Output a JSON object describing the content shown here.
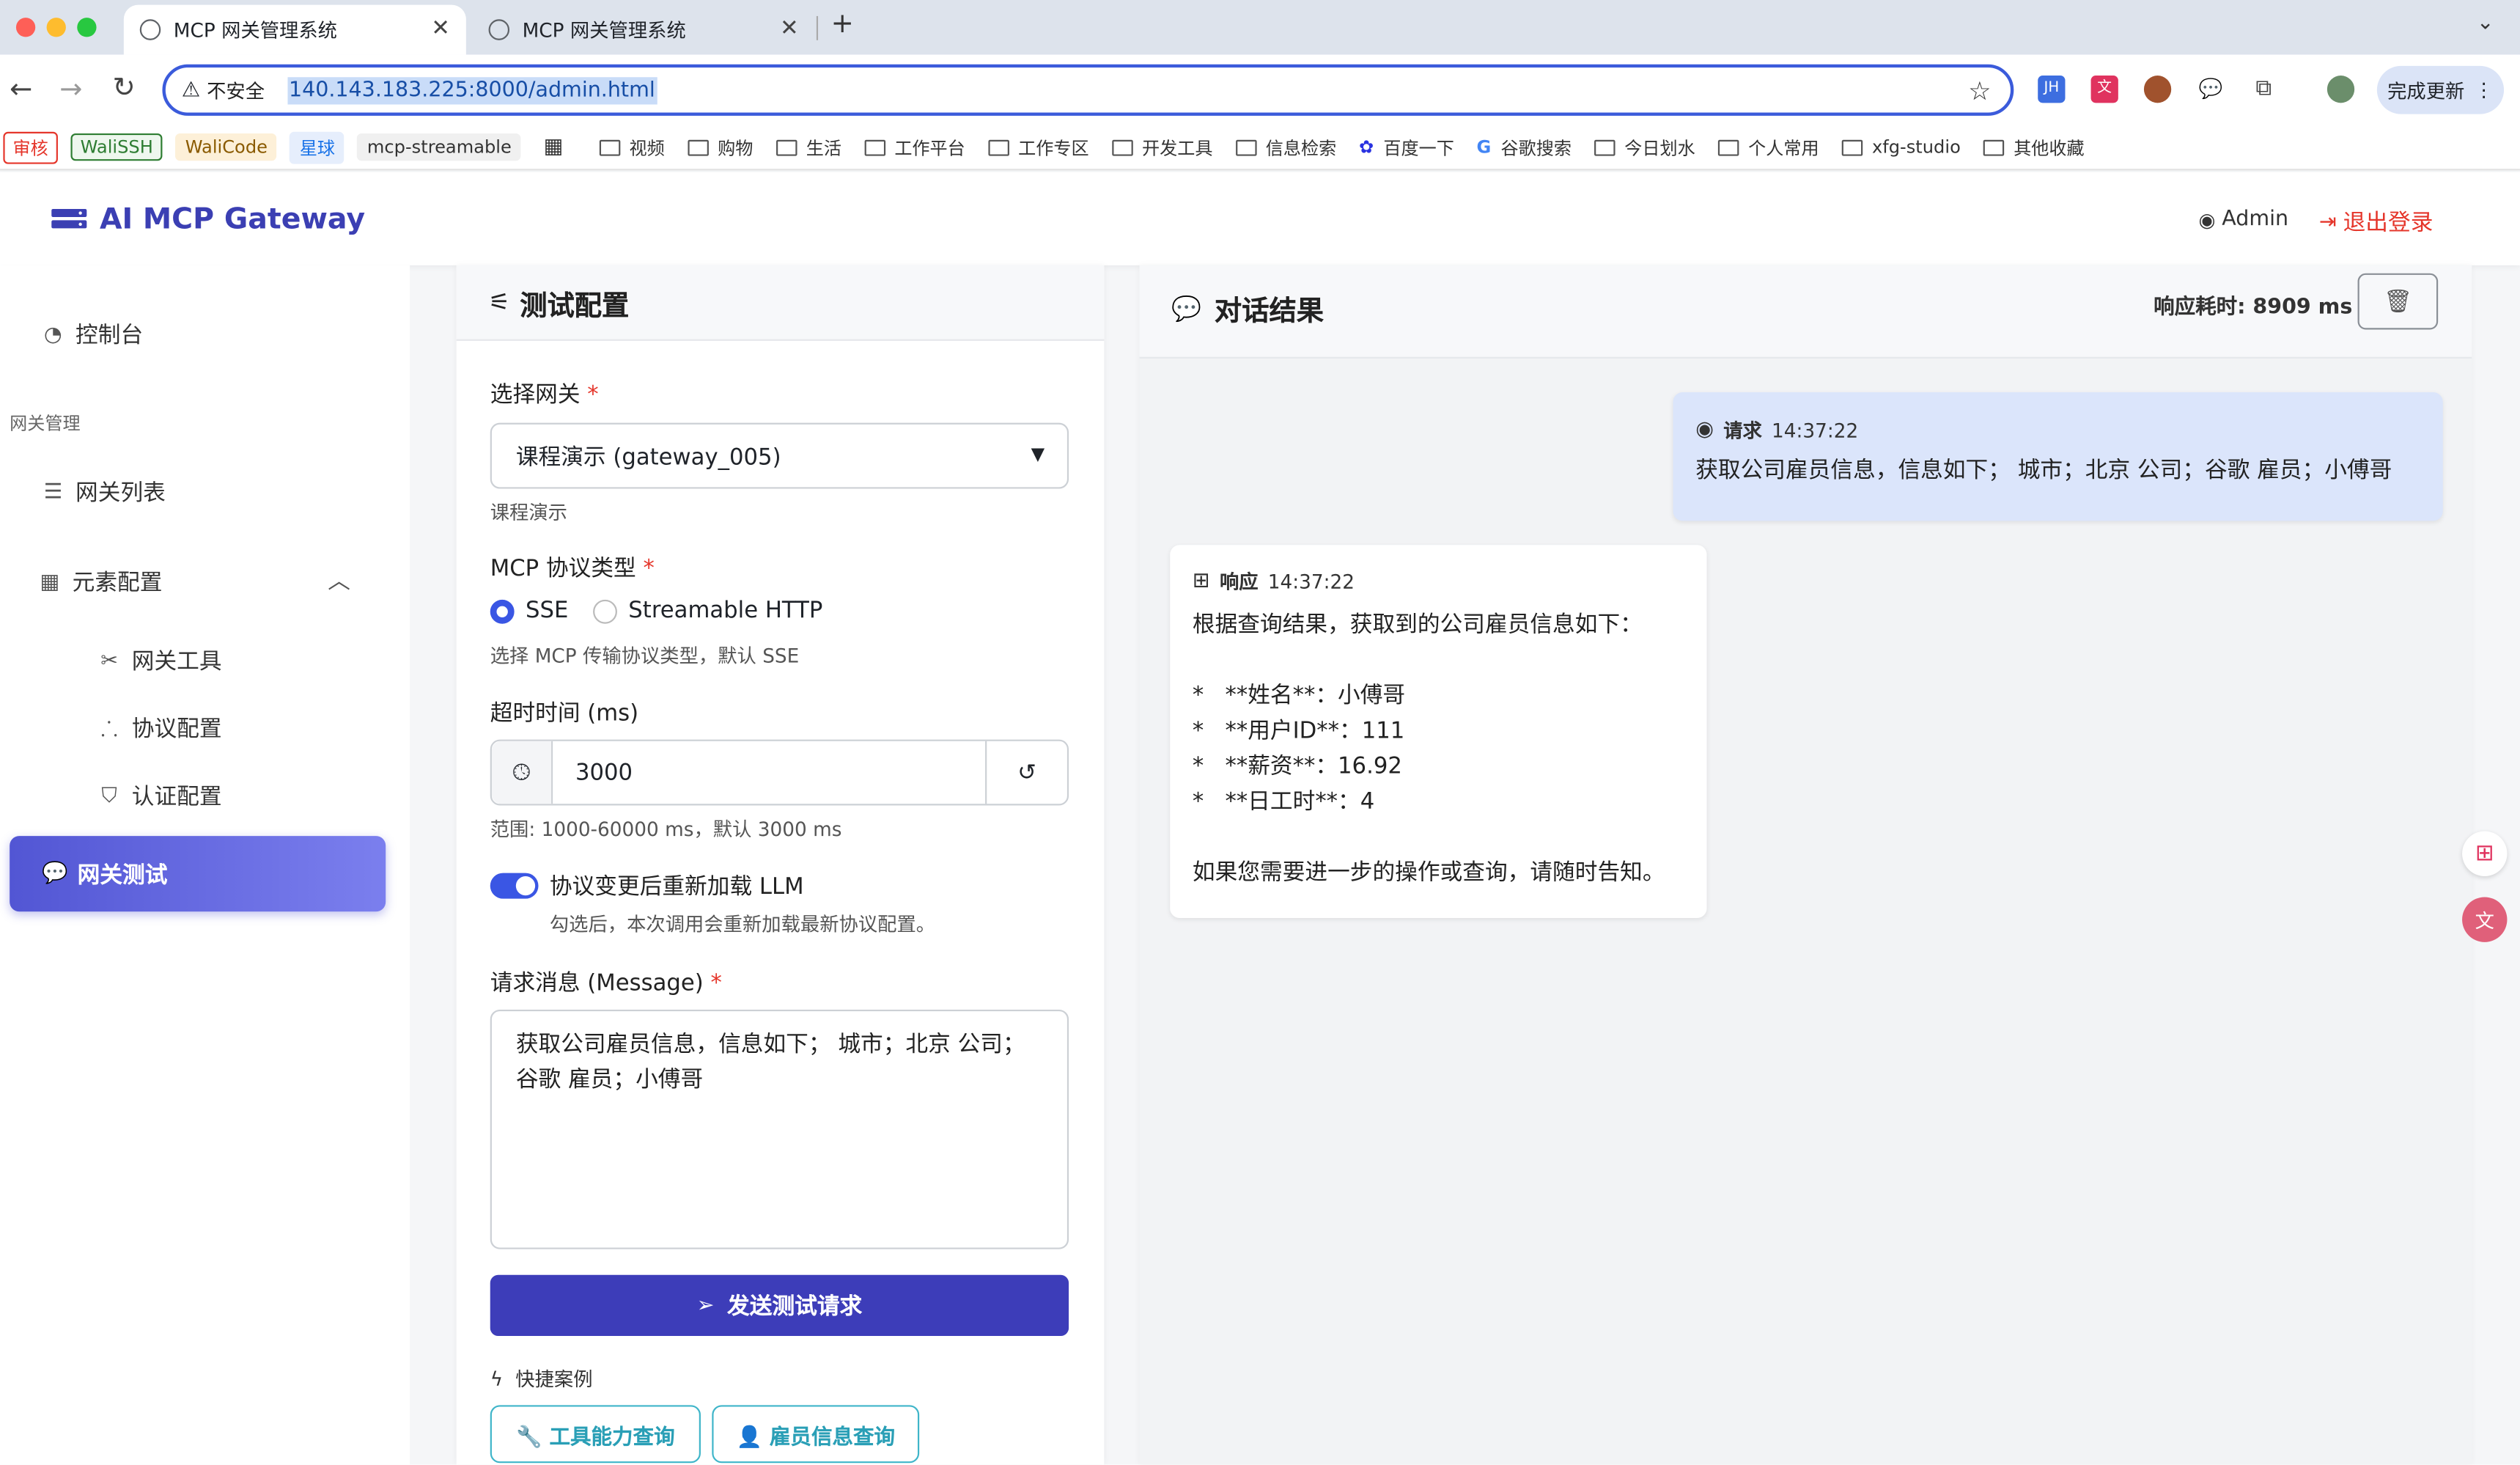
{
  "browser": {
    "tabs": [
      {
        "title": "MCP 网关管理系统",
        "active": true
      },
      {
        "title": "MCP 网关管理系统",
        "active": false
      }
    ],
    "new_tab": "+",
    "security_label": "不安全",
    "url": "140.143.183.225:8000/admin.html",
    "update_label": "完成更新",
    "extensions": [
      "JH",
      "文"
    ],
    "bookmarks": [
      {
        "label": "审核",
        "type": "chip",
        "color": "#e5362b"
      },
      {
        "label": "WaliSSH",
        "type": "chip",
        "color": "#2e7d32"
      },
      {
        "label": "WaliCode",
        "type": "chip",
        "color": "#8a5a00"
      },
      {
        "label": "星球",
        "type": "chip",
        "color": "#1a73e8"
      },
      {
        "label": "mcp-streamable",
        "type": "chip",
        "color": "#333333"
      },
      {
        "label": "视频",
        "type": "folder"
      },
      {
        "label": "购物",
        "type": "folder"
      },
      {
        "label": "生活",
        "type": "folder"
      },
      {
        "label": "工作平台",
        "type": "folder"
      },
      {
        "label": "工作专区",
        "type": "folder"
      },
      {
        "label": "开发工具",
        "type": "folder"
      },
      {
        "label": "信息检索",
        "type": "folder"
      },
      {
        "label": "百度一下",
        "type": "link"
      },
      {
        "label": "谷歌搜索",
        "type": "link"
      },
      {
        "label": "今日划水",
        "type": "folder"
      },
      {
        "label": "个人常用",
        "type": "folder"
      },
      {
        "label": "xfg-studio",
        "type": "folder"
      },
      {
        "label": "其他收藏",
        "type": "folder"
      }
    ]
  },
  "app": {
    "brand": "AI MCP Gateway",
    "user": "Admin",
    "logout": "退出登录",
    "brand_color": "#3b3fb3",
    "accent_color": "#3d3db9"
  },
  "sidebar": {
    "dashboard": "控制台",
    "section": "网关管理",
    "gateway_list": "网关列表",
    "element_config": "元素配置",
    "gateway_tools": "网关工具",
    "protocol_config": "协议配置",
    "auth_config": "认证配置",
    "gateway_test": "网关测试"
  },
  "test_config": {
    "title": "测试配置",
    "gateway_label": "选择网关",
    "required_mark": "*",
    "gateway_value": "课程演示 (gateway_005)",
    "gateway_hint": "课程演示",
    "protocol_label": "MCP 协议类型",
    "protocol_options": [
      "SSE",
      "Streamable HTTP"
    ],
    "protocol_selected": "SSE",
    "protocol_hint": "选择 MCP 传输协议类型，默认 SSE",
    "timeout_label": "超时时间 (ms)",
    "timeout_value": "3000",
    "timeout_hint": "范围: 1000-60000 ms，默认 3000 ms",
    "reload_label": "协议变更后重新加载 LLM",
    "reload_hint": "勾选后，本次调用会重新加载最新协议配置。",
    "reload_enabled": true,
    "message_label": "请求消息 (Message)",
    "message_value": "获取公司雇员信息，信息如下； 城市；北京 公司；谷歌 雇员；小傅哥",
    "send_label": "发送测试请求",
    "quick_label": "快捷案例",
    "quick_buttons": [
      "🔧 工具能力查询",
      "👤 雇员信息查询"
    ]
  },
  "result": {
    "title": "对话结果",
    "latency": "响应耗时: 8909 ms",
    "request": {
      "role": "请求",
      "time": "14:37:22",
      "text": "获取公司雇员信息，信息如下； 城市；北京 公司；谷歌 雇员；小傅哥"
    },
    "response": {
      "role": "响应",
      "time": "14:37:22",
      "intro": "根据查询结果，获取到的公司雇员信息如下：",
      "items": [
        "*   **姓名**：小傅哥",
        "*   **用户ID**：111",
        "*   **薪资**：16.92",
        "*   **日工时**：4"
      ],
      "outro": "如果您需要进一步的操作或查询，请随时告知。"
    }
  }
}
